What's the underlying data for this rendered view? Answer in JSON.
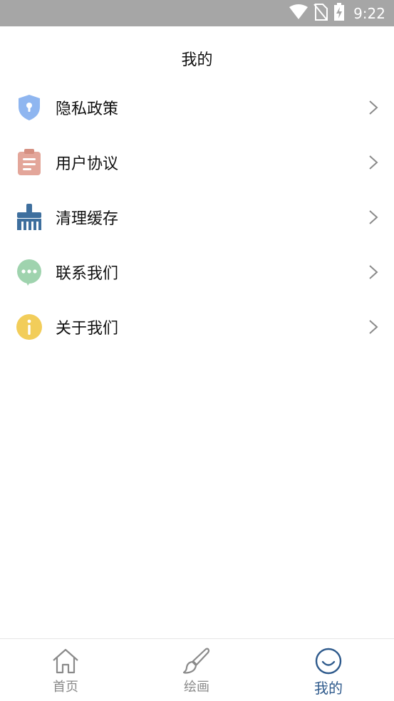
{
  "status_bar": {
    "time": "9:22",
    "icons": [
      "wifi-icon",
      "no-sim-icon",
      "battery-charging-icon"
    ]
  },
  "header": {
    "title": "我的"
  },
  "menu": {
    "items": [
      {
        "label": "隐私政策",
        "icon": "shield-lock-icon",
        "color": "#8fb6f0"
      },
      {
        "label": "用户协议",
        "icon": "clipboard-icon",
        "color": "#e3a69a"
      },
      {
        "label": "清理缓存",
        "icon": "broom-icon",
        "color": "#3e6f9e"
      },
      {
        "label": "联系我们",
        "icon": "chat-bubble-icon",
        "color": "#9fd3ae"
      },
      {
        "label": "关于我们",
        "icon": "info-icon",
        "color": "#f2cd5a"
      }
    ]
  },
  "tabbar": {
    "tabs": [
      {
        "label": "首页",
        "icon": "home-icon"
      },
      {
        "label": "绘画",
        "icon": "paintbrush-icon"
      },
      {
        "label": "我的",
        "icon": "smiley-icon",
        "active": true
      }
    ],
    "active_color": "#2e5a8c",
    "inactive_color": "#8a8a8a"
  }
}
